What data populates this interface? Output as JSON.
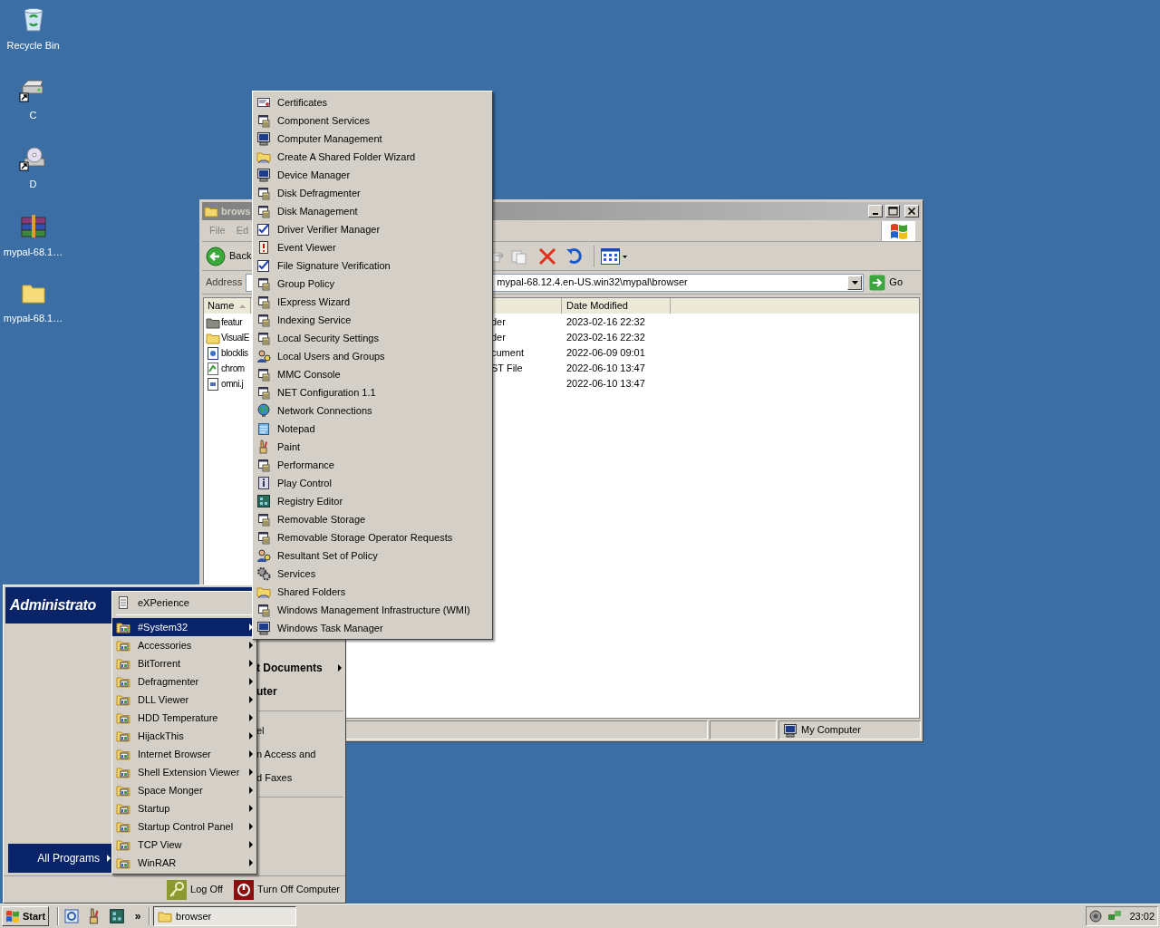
{
  "desktop_icons": [
    {
      "label": "Recycle Bin",
      "kind": "recycle"
    },
    {
      "label": "C",
      "kind": "drive"
    },
    {
      "label": "D",
      "kind": "cdrom"
    },
    {
      "label": "mypal-68.1…",
      "kind": "archive"
    },
    {
      "label": "mypal-68.1…",
      "kind": "folder"
    }
  ],
  "explorer": {
    "title": "brows",
    "menu": [
      "File",
      "Ed"
    ],
    "back": "Back",
    "address_label": "Address",
    "address": "mypal-68.12.4.en-US.win32\\mypal\\browser",
    "go": "Go",
    "columns": {
      "name": "Name",
      "date": "Date Modified"
    },
    "rows": [
      {
        "name": "featur",
        "kind": "dark-folder",
        "type": "der",
        "date": "2023-02-16 22:32"
      },
      {
        "name": "VisualE",
        "kind": "folder",
        "type": "der",
        "date": "2023-02-16 22:32"
      },
      {
        "name": "blocklis",
        "kind": "xml",
        "type": "cument",
        "date": "2022-06-09 09:01"
      },
      {
        "name": "chrom",
        "kind": "manifest",
        "type": "ST File",
        "date": "2022-06-10 13:47"
      },
      {
        "name": "omni.j",
        "kind": "archive",
        "date": "2022-06-10 13:47"
      }
    ],
    "status": "My Computer"
  },
  "start_menu": {
    "user": "Administrato",
    "right_items": [
      {
        "label": "t Documents",
        "kind": "bold",
        "submenu": true
      },
      {
        "label": "uter",
        "kind": "bold",
        "submenu": false
      },
      {
        "kind": "separator"
      },
      {
        "label": "el",
        "kind": "plain",
        "submenu": false
      },
      {
        "label": "n Access and",
        "kind": "plain",
        "submenu": false
      },
      {
        "label": "d Faxes",
        "kind": "plain",
        "submenu": false
      },
      {
        "kind": "separator"
      }
    ],
    "all_programs": "All Programs",
    "log_off": "Log Off",
    "turn_off": "Turn Off Computer"
  },
  "programs_menu": [
    {
      "label": "eXPerience",
      "kind": "program",
      "selected": false
    },
    {
      "kind": "separator"
    },
    {
      "label": "#System32",
      "kind": "folder",
      "selected": true
    },
    {
      "label": "Accessories",
      "kind": "folder",
      "selected": false
    },
    {
      "label": "BitTorrent",
      "kind": "folder",
      "selected": false
    },
    {
      "label": "Defragmenter",
      "kind": "folder",
      "selected": false
    },
    {
      "label": "DLL Viewer",
      "kind": "folder",
      "selected": false
    },
    {
      "label": "HDD Temperature",
      "kind": "folder",
      "selected": false
    },
    {
      "label": "HijackThis",
      "kind": "folder",
      "selected": false
    },
    {
      "label": "Internet Browser",
      "kind": "folder",
      "selected": false
    },
    {
      "label": "Shell Extension Viewer",
      "kind": "folder",
      "selected": false
    },
    {
      "label": "Space Monger",
      "kind": "folder",
      "selected": false
    },
    {
      "label": "Startup",
      "kind": "folder",
      "selected": false
    },
    {
      "label": "Startup Control Panel",
      "kind": "folder",
      "selected": false
    },
    {
      "label": "TCP View",
      "kind": "folder",
      "selected": false
    },
    {
      "label": "WinRAR",
      "kind": "folder",
      "selected": false
    }
  ],
  "system32_menu": [
    {
      "label": "Certificates",
      "kind": "certificate"
    },
    {
      "label": "Component Services",
      "kind": "console"
    },
    {
      "label": "Computer Management",
      "kind": "computer"
    },
    {
      "label": "Create A Shared Folder Wizard",
      "kind": "shared-folder"
    },
    {
      "label": "Device Manager",
      "kind": "computer"
    },
    {
      "label": "Disk Defragmenter",
      "kind": "console"
    },
    {
      "label": "Disk Management",
      "kind": "console"
    },
    {
      "label": "Driver Verifier Manager",
      "kind": "check"
    },
    {
      "label": "Event Viewer",
      "kind": "event"
    },
    {
      "label": "File Signature Verification",
      "kind": "check"
    },
    {
      "label": "Group Policy",
      "kind": "console"
    },
    {
      "label": "IExpress Wizard",
      "kind": "console"
    },
    {
      "label": "Indexing Service",
      "kind": "console"
    },
    {
      "label": "Local Security Settings",
      "kind": "console"
    },
    {
      "label": "Local Users and Groups",
      "kind": "users"
    },
    {
      "label": "MMC Console",
      "kind": "console"
    },
    {
      "label": "NET Configuration 1.1",
      "kind": "console"
    },
    {
      "label": "Network Connections",
      "kind": "globe"
    },
    {
      "label": "Notepad",
      "kind": "notepad"
    },
    {
      "label": "Paint",
      "kind": "paint"
    },
    {
      "label": "Performance",
      "kind": "console"
    },
    {
      "label": "Play Control",
      "kind": "info"
    },
    {
      "label": "Registry Editor",
      "kind": "registry"
    },
    {
      "label": "Removable Storage",
      "kind": "console"
    },
    {
      "label": "Removable Storage Operator Requests",
      "kind": "console"
    },
    {
      "label": "Resultant Set of Policy",
      "kind": "users"
    },
    {
      "label": "Services",
      "kind": "gear"
    },
    {
      "label": "Shared Folders",
      "kind": "shared-folder"
    },
    {
      "label": "Windows Management Infrastructure (WMI)",
      "kind": "console"
    },
    {
      "label": "Windows Task Manager",
      "kind": "computer"
    }
  ],
  "taskbar": {
    "start": "Start",
    "chevron": "»",
    "tasks": [
      {
        "label": "browser",
        "selected": true
      }
    ],
    "clock": "23:02"
  }
}
